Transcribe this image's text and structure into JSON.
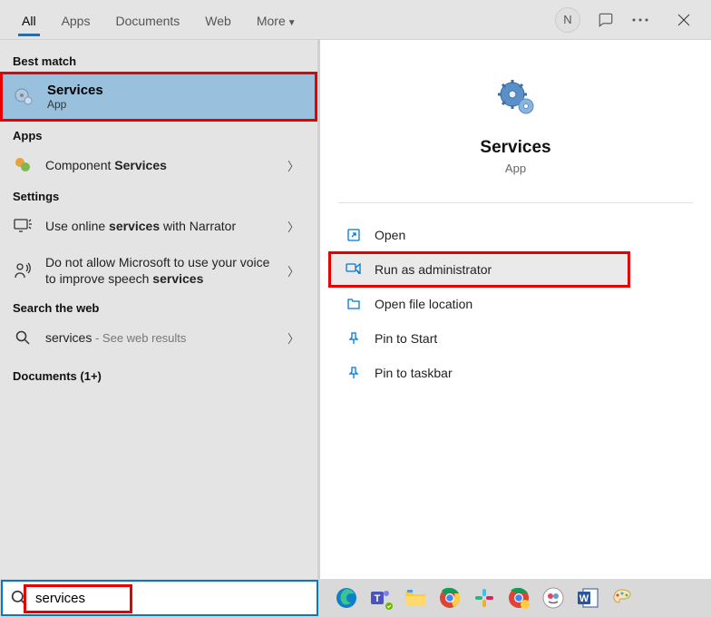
{
  "header": {
    "tabs": [
      "All",
      "Apps",
      "Documents",
      "Web",
      "More"
    ],
    "avatar_letter": "N"
  },
  "left": {
    "best_match_label": "Best match",
    "best_match": {
      "title": "Services",
      "sub": "App"
    },
    "apps_label": "Apps",
    "apps": [
      {
        "prefix": "Component ",
        "bold": "Services"
      }
    ],
    "settings_label": "Settings",
    "settings": [
      {
        "p1": "Use online ",
        "b1": "services",
        "p2": " with Narrator"
      },
      {
        "p1": "Do not allow Microsoft to use your voice to improve speech ",
        "b1": "services",
        "p2": ""
      }
    ],
    "web_label": "Search the web",
    "web": {
      "query": "services",
      "suffix": " - See web results"
    },
    "docs_label": "Documents (1+)"
  },
  "right": {
    "title": "Services",
    "sub": "App",
    "actions": [
      {
        "label": "Open",
        "icon": "open"
      },
      {
        "label": "Run as administrator",
        "icon": "admin",
        "highlighted": true
      },
      {
        "label": "Open file location",
        "icon": "folder"
      },
      {
        "label": "Pin to Start",
        "icon": "pin"
      },
      {
        "label": "Pin to taskbar",
        "icon": "pin"
      }
    ]
  },
  "search": {
    "value": "services"
  },
  "tray_icons": [
    "edge",
    "teams",
    "explorer",
    "chrome",
    "slack",
    "chrome2",
    "snagit",
    "word",
    "paint"
  ]
}
